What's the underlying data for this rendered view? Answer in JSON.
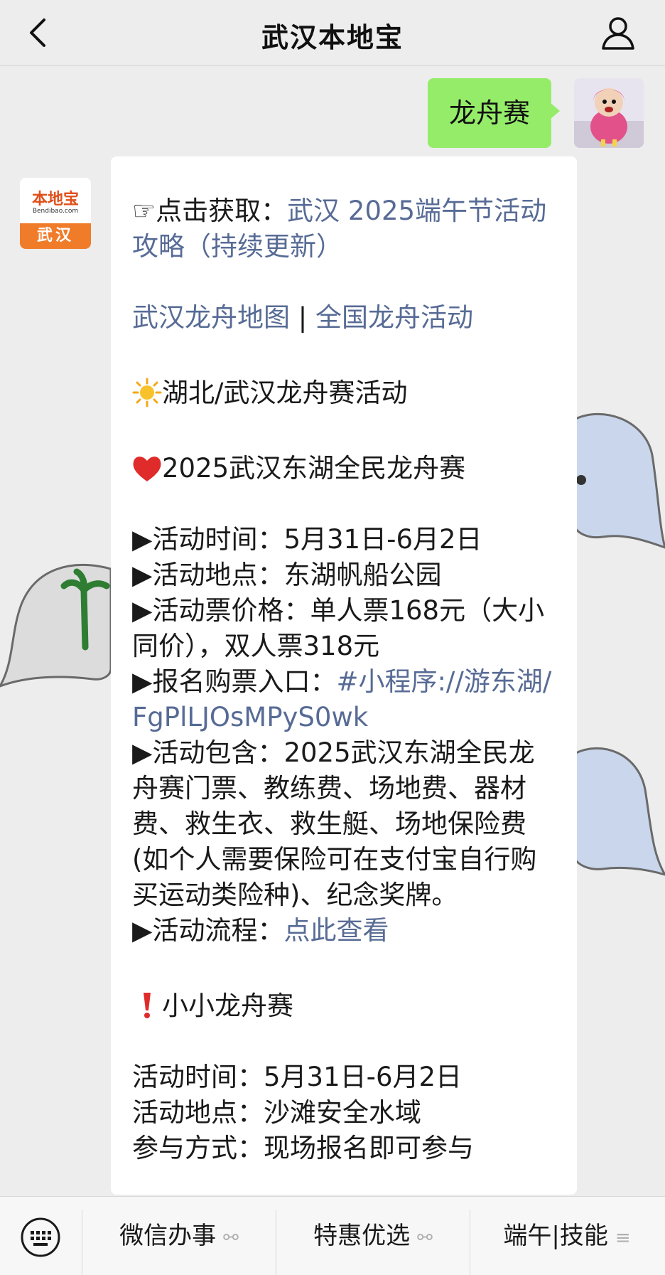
{
  "header": {
    "title": "武汉本地宝"
  },
  "user_message": {
    "text": "龙舟赛"
  },
  "bot_avatar": {
    "logo_text": "本地宝",
    "logo_url": "Bendibao.com",
    "city": "武汉"
  },
  "message": {
    "l1_prefix": "☞点击获取：",
    "l1_link": "武汉 2025端午节活动攻略（持续更新）",
    "map_link": "武汉龙舟地图",
    "separator": " | ",
    "national_link": "全国龙舟活动",
    "section1_title": "湖北/武汉龙舟赛活动",
    "event1_title": "2025武汉东湖全民龙舟赛",
    "time_label": "▶活动时间：",
    "time_value": "5月31日-6月2日",
    "place_label": "▶活动地点：",
    "place_value": "东湖帆船公园",
    "price_label": "▶活动票价格：",
    "price_value": "单人票168元（大小同价），双人票318元",
    "signup_label": "▶报名购票入口：",
    "signup_link": "#小程序://游东湖/FgPlLJOsMPyS0wk",
    "includes_label": "▶活动包含：",
    "includes_value": "2025武汉东湖全民龙舟赛门票、教练费、场地费、器材费、救生衣、救生艇、场地保险费 (如个人需要保险可在支付宝自行购买运动类险种)、纪念奖牌。",
    "process_label": "▶活动流程：",
    "process_link": "点此查看",
    "event2_title": "小小龙舟赛",
    "e2_time_label": "活动时间：",
    "e2_time_value": "5月31日-6月2日",
    "e2_place_label": "活动地点：",
    "e2_place_value": "沙滩安全水域",
    "e2_join_label": "参与方式：",
    "e2_join_value": "现场报名即可参与"
  },
  "bottom_menu": {
    "item1": "微信办事",
    "item2": "特惠优选",
    "item3": "端午|技能"
  },
  "icons": [
    "back-icon",
    "profile-icon",
    "keyboard-icon",
    "sun-emoji",
    "heart-emoji",
    "exclamation-emoji",
    "link-icon",
    "menu-icon"
  ]
}
